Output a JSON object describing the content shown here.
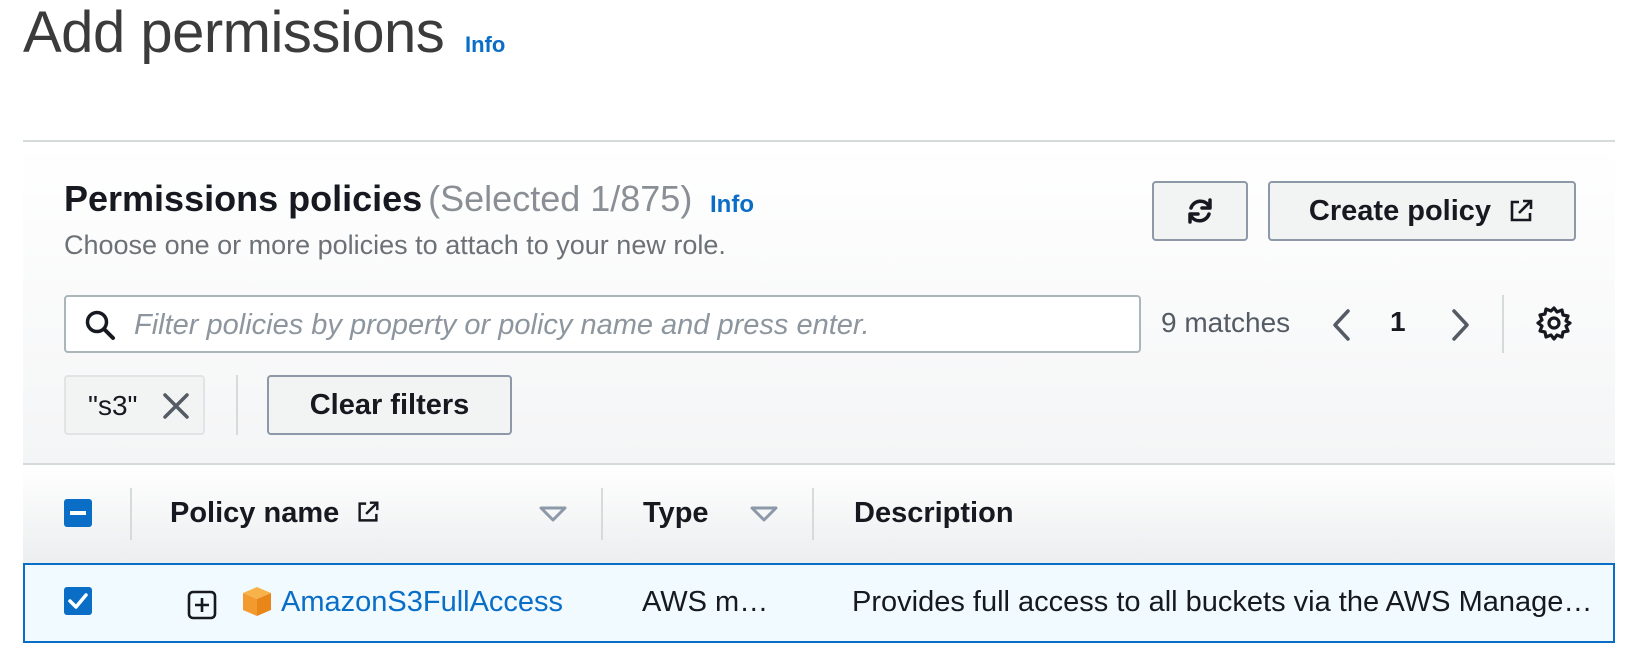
{
  "page": {
    "title": "Add permissions",
    "info_link": "Info"
  },
  "policies_panel": {
    "heading": "Permissions policies",
    "selected_count": "(Selected 1/875)",
    "info_link": "Info",
    "description": "Choose one or more policies to attach to your new role.",
    "create_policy_label": "Create policy",
    "refresh_icon": "refresh-icon",
    "external_icon": "external-link-icon"
  },
  "filter": {
    "placeholder": "Filter policies by property or policy name and press enter.",
    "value": "",
    "matches": "9 matches",
    "current_page": "1",
    "tokens": [
      {
        "label": "\"s3\""
      }
    ],
    "clear_filters_label": "Clear filters"
  },
  "table": {
    "columns": [
      {
        "label": "Policy name"
      },
      {
        "label": "Type"
      },
      {
        "label": "Description"
      }
    ],
    "rows": [
      {
        "selected": true,
        "policy_name": "AmazonS3FullAccess",
        "type": "AWS m…",
        "description": "Provides full access to all buckets via the AWS Manage…"
      }
    ]
  },
  "colors": {
    "accent": "#0a6ec7",
    "package": "#f29a2e",
    "selected_row_bg": "#f1faff"
  }
}
